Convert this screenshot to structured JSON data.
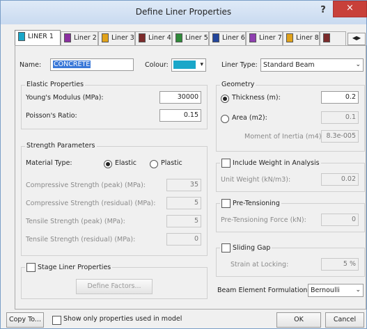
{
  "window": {
    "title": "Define Liner Properties",
    "help_glyph": "?",
    "close_glyph": "×"
  },
  "tabs": [
    {
      "label": "LINER 1",
      "color": "#1aa7c9",
      "active": true
    },
    {
      "label": "Liner 2",
      "color": "#8b2fa0"
    },
    {
      "label": "Liner 3",
      "color": "#e0a21b"
    },
    {
      "label": "Liner 4",
      "color": "#7c2b2b"
    },
    {
      "label": "Liner 5",
      "color": "#2f8a3a"
    },
    {
      "label": "Liner 6",
      "color": "#23469c"
    },
    {
      "label": "Liner 7",
      "color": "#8f3fb0"
    },
    {
      "label": "Liner 8",
      "color": "#e0a21b"
    },
    {
      "label": "",
      "color": "#7c2b2b"
    }
  ],
  "tab_arrows": "◀▶",
  "general": {
    "name_label": "Name:",
    "name_value": "CONCRETE",
    "colour_label": "Colour:",
    "colour_value": "#1aa7c9",
    "liner_type_label": "Liner Type:",
    "liner_type_value": "Standard Beam"
  },
  "elastic": {
    "title": "Elastic Properties",
    "youngs_label": "Young's Modulus (MPa):",
    "youngs_value": "30000",
    "poisson_label": "Poisson's Ratio:",
    "poisson_value": "0.15"
  },
  "strength": {
    "title": "Strength Parameters",
    "material_type_label": "Material Type:",
    "elastic_label": "Elastic",
    "plastic_label": "Plastic",
    "selected": "Elastic",
    "rows": [
      {
        "label": "Compressive Strength (peak) (MPa):",
        "value": "35"
      },
      {
        "label": "Compressive Strength (residual) (MPa):",
        "value": "5"
      },
      {
        "label": "Tensile Strength (peak) (MPa):",
        "value": "5"
      },
      {
        "label": "Tensile Strength (residual) (MPa):",
        "value": "0"
      }
    ]
  },
  "stage": {
    "label": "Stage Liner Properties",
    "button": "Define Factors..."
  },
  "geometry": {
    "title": "Geometry",
    "thickness_label": "Thickness (m):",
    "thickness_value": "0.2",
    "area_label": "Area (m2):",
    "area_value": "0.1",
    "moment_label": "Moment of Inertia (m4):",
    "moment_value": "8.3e-005"
  },
  "weight": {
    "label": "Include Weight in Analysis",
    "unit_weight_label": "Unit Weight (kN/m3):",
    "unit_weight_value": "0.02"
  },
  "pretension": {
    "label": "Pre-Tensioning",
    "force_label": "Pre-Tensioning Force (kN):",
    "force_value": "0"
  },
  "sliding": {
    "label": "Sliding Gap",
    "strain_label": "Strain at Locking:",
    "strain_value": "5 %"
  },
  "formulation": {
    "label": "Beam Element Formulation:",
    "value": "Bernoulli"
  },
  "footer": {
    "copy_button": "Copy To...",
    "show_only_label": "Show only properties used in model",
    "ok_button": "OK",
    "cancel_button": "Cancel"
  }
}
